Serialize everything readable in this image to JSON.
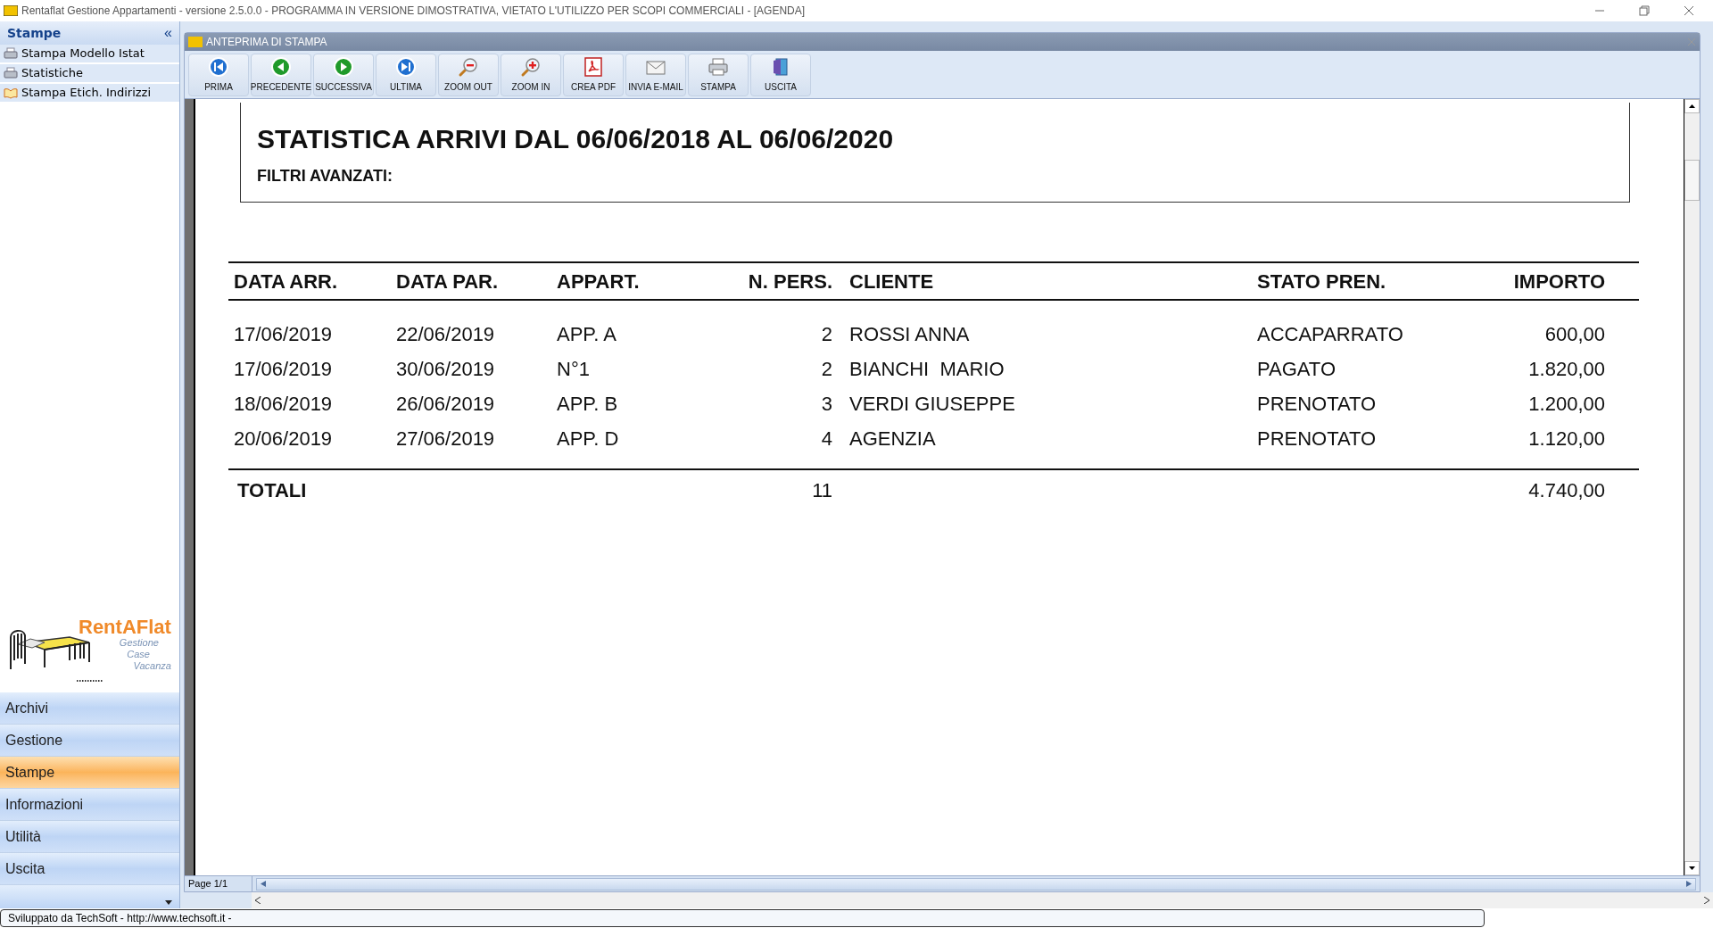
{
  "window": {
    "title": "Rentaflat Gestione Appartamenti - versione 2.5.0.0 - PROGRAMMA IN VERSIONE DIMOSTRATIVA, VIETATO L'UTILIZZO PER SCOPI COMMERCIALI - [AGENDA]"
  },
  "sidebar": {
    "header": "Stampe",
    "collapse": "«",
    "items": [
      {
        "label": "Stampa Modello Istat",
        "kind": "printer"
      },
      {
        "label": "Statistiche",
        "kind": "printer"
      },
      {
        "label": "Stampa Etich. Indirizzi",
        "kind": "book"
      }
    ],
    "logo": {
      "name": "RentAFlat",
      "tagline": [
        "Gestione",
        "Case",
        "Vacanza"
      ]
    },
    "nav": [
      {
        "label": "Archivi",
        "selected": false
      },
      {
        "label": "Gestione",
        "selected": false
      },
      {
        "label": "Stampe",
        "selected": true
      },
      {
        "label": "Informazioni",
        "selected": false
      },
      {
        "label": "Utilità",
        "selected": false
      },
      {
        "label": "Uscita",
        "selected": false
      }
    ]
  },
  "preview": {
    "title": "ANTEPRIMA DI STAMPA",
    "toolbar": [
      {
        "label": "PRIMA",
        "kind": "first"
      },
      {
        "label": "PRECEDENTE",
        "kind": "prev"
      },
      {
        "label": "SUCCESSIVA",
        "kind": "next"
      },
      {
        "label": "ULTIMA",
        "kind": "last"
      },
      {
        "label": "ZOOM OUT",
        "kind": "zoom_out"
      },
      {
        "label": "ZOOM IN",
        "kind": "zoom_in"
      },
      {
        "label": "CREA PDF",
        "kind": "pdf"
      },
      {
        "label": "INVIA E-MAIL",
        "kind": "email"
      },
      {
        "label": "STAMPA",
        "kind": "print"
      },
      {
        "label": "USCITA",
        "kind": "exit"
      }
    ],
    "report": {
      "title": "STATISTICA ARRIVI DAL 06/06/2018 AL 06/06/2020",
      "filters": "FILTRI AVANZATI:",
      "columns": [
        {
          "label": "DATA ARR.",
          "kind": "text"
        },
        {
          "label": "DATA PAR.",
          "kind": "text"
        },
        {
          "label": "APPART.",
          "kind": "text"
        },
        {
          "label": "N. PERS.",
          "kind": "number"
        },
        {
          "label": "CLIENTE",
          "kind": "text"
        },
        {
          "label": "STATO PREN.",
          "kind": "text"
        },
        {
          "label": "IMPORTO",
          "kind": "number"
        }
      ],
      "rows": [
        [
          "17/06/2019",
          "22/06/2019",
          "APP. A",
          "2",
          "ROSSI ANNA",
          "ACCAPARRATO",
          "600,00"
        ],
        [
          "17/06/2019",
          "30/06/2019",
          "N°1",
          "2",
          "BIANCHI  MARIO",
          "PAGATO",
          "1.820,00"
        ],
        [
          "18/06/2019",
          "26/06/2019",
          "APP. B",
          "3",
          "VERDI GIUSEPPE",
          "PRENOTATO",
          "1.200,00"
        ],
        [
          "20/06/2019",
          "27/06/2019",
          "APP. D",
          "4",
          "AGENZIA",
          "PRENOTATO",
          "1.120,00"
        ]
      ],
      "totals": {
        "label": "TOTALI",
        "persons": "11",
        "amount": "4.740,00"
      }
    },
    "page_indicator": "Page 1/1"
  },
  "status_bar": "Sviluppato da TechSoft - http://www.techsoft.it -"
}
